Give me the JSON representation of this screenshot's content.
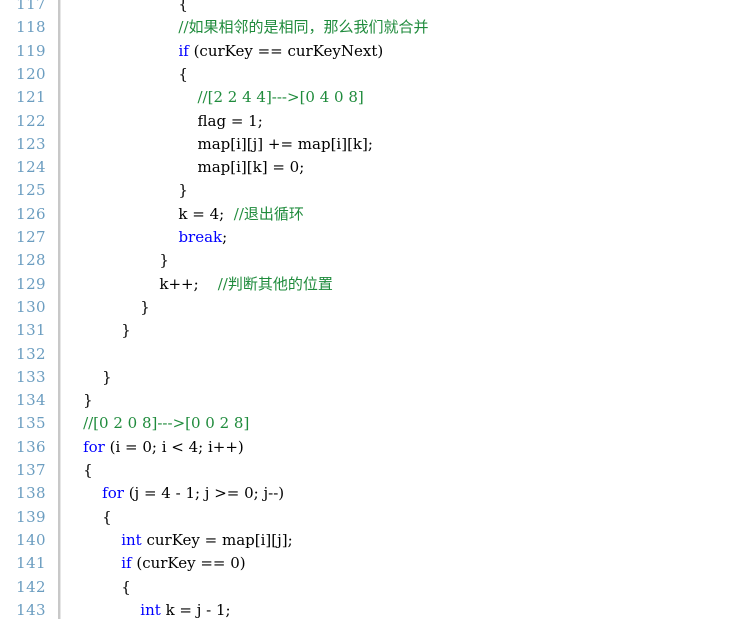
{
  "editor": {
    "language": "C++",
    "theme": "light",
    "colors": {
      "background": "#ffffff",
      "text": "#000000",
      "keyword": "#0000ff",
      "comment": "#1f8b3c",
      "line_number": "#6b9dc0",
      "gutter_divider": "#c8c8c8"
    },
    "first_visible_line": 117,
    "last_visible_line": 143,
    "indent_unit_spaces": 4,
    "lines": [
      {
        "number": "117",
        "clipped_top": true,
        "tokens": [
          {
            "type": "plain",
            "text": "                        {"
          }
        ]
      },
      {
        "number": "118",
        "tokens": [
          {
            "type": "comment",
            "text": "                        //如果相邻的是相同，那么我们就合并"
          }
        ]
      },
      {
        "number": "119",
        "tokens": [
          {
            "type": "plain",
            "text": "                        "
          },
          {
            "type": "keyword",
            "text": "if"
          },
          {
            "type": "plain",
            "text": " (curKey == curKeyNext)"
          }
        ]
      },
      {
        "number": "120",
        "tokens": [
          {
            "type": "plain",
            "text": "                        {"
          }
        ]
      },
      {
        "number": "121",
        "tokens": [
          {
            "type": "comment",
            "text": "                            //[2 2 4 4]--->[0 4 0 8]"
          }
        ]
      },
      {
        "number": "122",
        "tokens": [
          {
            "type": "plain",
            "text": "                            flag = 1;"
          }
        ]
      },
      {
        "number": "123",
        "tokens": [
          {
            "type": "plain",
            "text": "                            map[i][j] += map[i][k];"
          }
        ]
      },
      {
        "number": "124",
        "tokens": [
          {
            "type": "plain",
            "text": "                            map[i][k] = 0;"
          }
        ]
      },
      {
        "number": "125",
        "tokens": [
          {
            "type": "plain",
            "text": "                        }"
          }
        ]
      },
      {
        "number": "126",
        "tokens": [
          {
            "type": "plain",
            "text": "                        k = 4;  "
          },
          {
            "type": "comment",
            "text": "//退出循环"
          }
        ]
      },
      {
        "number": "127",
        "tokens": [
          {
            "type": "plain",
            "text": "                        "
          },
          {
            "type": "keyword",
            "text": "break"
          },
          {
            "type": "plain",
            "text": ";"
          }
        ]
      },
      {
        "number": "128",
        "tokens": [
          {
            "type": "plain",
            "text": "                    }"
          }
        ]
      },
      {
        "number": "129",
        "tokens": [
          {
            "type": "plain",
            "text": "                    k++;    "
          },
          {
            "type": "comment",
            "text": "//判断其他的位置"
          }
        ]
      },
      {
        "number": "130",
        "tokens": [
          {
            "type": "plain",
            "text": "                }"
          }
        ]
      },
      {
        "number": "131",
        "tokens": [
          {
            "type": "plain",
            "text": "            }"
          }
        ]
      },
      {
        "number": "132",
        "tokens": [
          {
            "type": "plain",
            "text": ""
          }
        ]
      },
      {
        "number": "133",
        "tokens": [
          {
            "type": "plain",
            "text": "        }"
          }
        ]
      },
      {
        "number": "134",
        "tokens": [
          {
            "type": "plain",
            "text": "    }"
          }
        ]
      },
      {
        "number": "135",
        "tokens": [
          {
            "type": "comment",
            "text": "    //[0 2 0 8]--->[0 0 2 8]"
          }
        ]
      },
      {
        "number": "136",
        "tokens": [
          {
            "type": "plain",
            "text": "    "
          },
          {
            "type": "keyword",
            "text": "for"
          },
          {
            "type": "plain",
            "text": " (i = 0; i < 4; i++)"
          }
        ]
      },
      {
        "number": "137",
        "tokens": [
          {
            "type": "plain",
            "text": "    {"
          }
        ]
      },
      {
        "number": "138",
        "tokens": [
          {
            "type": "plain",
            "text": "        "
          },
          {
            "type": "keyword",
            "text": "for"
          },
          {
            "type": "plain",
            "text": " (j = 4 - 1; j >= 0; j--)"
          }
        ]
      },
      {
        "number": "139",
        "tokens": [
          {
            "type": "plain",
            "text": "        {"
          }
        ]
      },
      {
        "number": "140",
        "tokens": [
          {
            "type": "plain",
            "text": "            "
          },
          {
            "type": "keyword",
            "text": "int"
          },
          {
            "type": "plain",
            "text": " curKey = map[i][j];"
          }
        ]
      },
      {
        "number": "141",
        "tokens": [
          {
            "type": "plain",
            "text": "            "
          },
          {
            "type": "keyword",
            "text": "if"
          },
          {
            "type": "plain",
            "text": " (curKey == 0)"
          }
        ]
      },
      {
        "number": "142",
        "tokens": [
          {
            "type": "plain",
            "text": "            {"
          }
        ]
      },
      {
        "number": "143",
        "tokens": [
          {
            "type": "plain",
            "text": "                "
          },
          {
            "type": "keyword",
            "text": "int"
          },
          {
            "type": "plain",
            "text": " k = j - 1;"
          }
        ]
      }
    ]
  }
}
